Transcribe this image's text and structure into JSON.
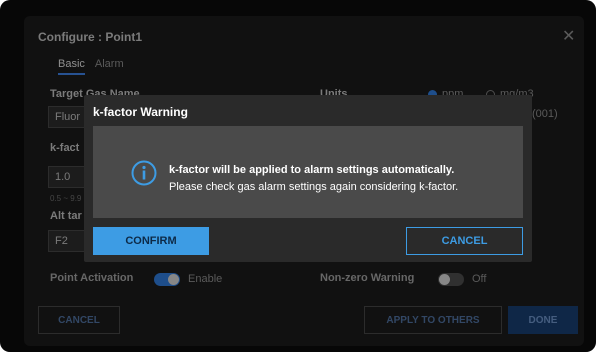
{
  "config": {
    "title": "Configure : Point1",
    "tabs": [
      {
        "label": "Basic",
        "active": true
      },
      {
        "label": "Alarm",
        "active": false
      }
    ],
    "target_gas_label": "Target Gas Name",
    "target_gas_value": "Fluor",
    "units_label": "Units",
    "units_options": [
      "ppm",
      "mg/m3"
    ],
    "units_selected": "ppm",
    "units_hint": "(001)",
    "kfactor_label": "k-fact",
    "kfactor_value": "1.0",
    "kfactor_hint": "0.5 ~ 9.9",
    "alt_target_label": "Alt tar",
    "alt_target_value": "F2",
    "point_activation_label": "Point Activation",
    "point_activation_state": "Enable",
    "nonzero_warning_label": "Non-zero Warning",
    "nonzero_warning_state": "Off",
    "cancel_button": "CANCEL",
    "apply_button": "APPLY TO OTHERS",
    "done_button": "DONE"
  },
  "modal": {
    "title": "k-factor Warning",
    "message_primary": "k-factor will be applied to alarm settings automatically.",
    "message_secondary": "Please check gas alarm settings again considering k-factor.",
    "confirm_label": "CONFIRM",
    "cancel_label": "CANCEL"
  },
  "colors": {
    "accent": "#3d9ce4",
    "modal_bg": "#2a2a2a",
    "modal_body_bg": "#4a4a4a",
    "toggle_on": "#2e78d6",
    "toggle_off": "#4a4a4a"
  }
}
